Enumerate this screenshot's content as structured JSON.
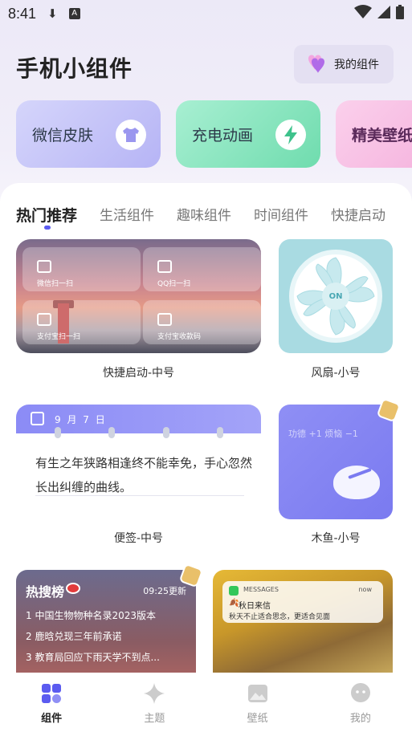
{
  "status_bar": {
    "time": "8:41"
  },
  "header": {
    "title": "手机小组件",
    "my_widgets_label": "我的组件"
  },
  "top_cards": [
    {
      "label": "微信皮肤",
      "icon": "tshirt-icon"
    },
    {
      "label": "充电动画",
      "icon": "lightning-icon"
    },
    {
      "label": "精美壁纸",
      "icon": ""
    }
  ],
  "tabs": [
    "热门推荐",
    "生活组件",
    "趣味组件",
    "时间组件",
    "快捷启动"
  ],
  "widgets": {
    "quick_launch": {
      "label": "快捷启动-中号",
      "buttons": [
        "微信扫一扫",
        "QQ扫一扫",
        "支付宝扫一扫",
        "支付宝收款码"
      ]
    },
    "fan": {
      "label": "风扇-小号",
      "on_text": "ON"
    },
    "note": {
      "label": "便签-中号",
      "date": "9 月 7 日",
      "text": "有生之年狭路相逢终不能幸免，手心忽然长出纠缠的曲线。"
    },
    "wooden_fish": {
      "label": "木鱼-小号",
      "counter_text": "功德 +1    烦恼 −1"
    },
    "hot_search": {
      "title": "热搜榜",
      "time": "09:25更新",
      "items": [
        "1 中国生物物种名录2023版本",
        "2 鹿晗兑现三年前承诺",
        "3 教育局回应下雨天学不到点..."
      ]
    },
    "message": {
      "app": "MESSAGES",
      "time": "now",
      "title": "秋日来信",
      "body": "秋天不止适合思念，更适合见面"
    }
  },
  "bottom_nav": [
    {
      "label": "组件",
      "active": true
    },
    {
      "label": "主题",
      "active": false
    },
    {
      "label": "壁纸",
      "active": false
    },
    {
      "label": "我的",
      "active": false
    }
  ],
  "colors": {
    "accent": "#5b5bf0",
    "charge_green": "#6fdcae",
    "wechat_purple": "#b6b4f5"
  }
}
